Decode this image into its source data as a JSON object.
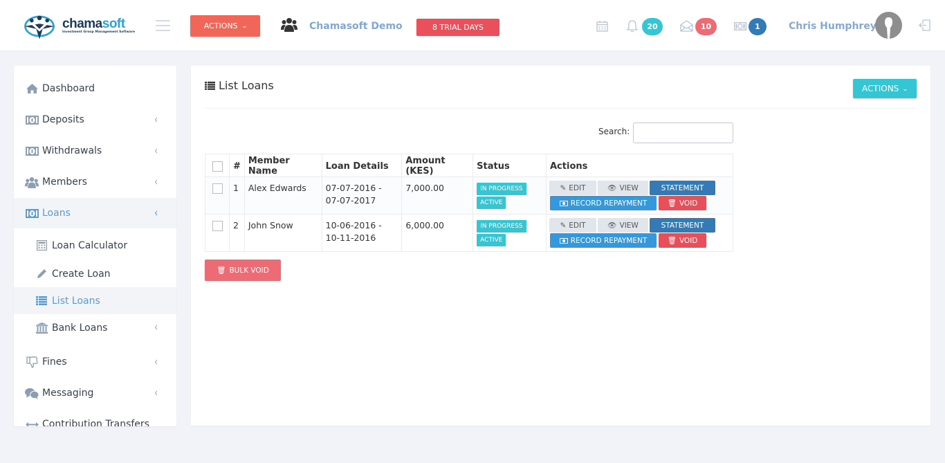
{
  "header": {
    "logo": {
      "name_part1": "chama",
      "name_part2": "soft",
      "tagline": "Investment Group Management Software"
    },
    "menu_icon": "hamburger-icon",
    "actions_label": "ACTIONS",
    "group_icon": "users-icon",
    "group_name": "Chamasoft Demo",
    "trial_label": "8 TRIAL DAYS",
    "notifications": [
      {
        "icon": "calendar-icon",
        "count": null
      },
      {
        "icon": "bell-icon",
        "count": "20",
        "color": "#36c6d3"
      },
      {
        "icon": "envelope-open-icon",
        "count": "10",
        "color": "#ed6b75"
      },
      {
        "icon": "money-icon",
        "count": "1",
        "color": "#337ab7"
      }
    ],
    "user_name": "Chris Humphreys",
    "logout_icon": "logout-icon"
  },
  "sidebar": {
    "items": [
      {
        "label": "Dashboard",
        "icon": "home-icon",
        "has_arrow": false
      },
      {
        "label": "Deposits",
        "icon": "money-icon",
        "has_arrow": true
      },
      {
        "label": "Withdrawals",
        "icon": "money-icon",
        "has_arrow": true
      },
      {
        "label": "Members",
        "icon": "users-icon",
        "has_arrow": true
      },
      {
        "label": "Loans",
        "icon": "money-icon",
        "has_arrow": true,
        "active": true
      },
      {
        "label": "Loan Calculator",
        "icon": "calculator-icon",
        "sub": true
      },
      {
        "label": "Create Loan",
        "icon": "pencil-icon",
        "sub": true
      },
      {
        "label": "List Loans",
        "icon": "list-icon",
        "sub": true,
        "active": true
      },
      {
        "label": "Bank Loans",
        "icon": "bank-icon",
        "sub": true,
        "has_arrow": true
      },
      {
        "label": "Fines",
        "icon": "thumbs-down-icon",
        "has_arrow": true
      },
      {
        "label": "Messaging",
        "icon": "chat-icon",
        "has_arrow": true
      },
      {
        "label": "Contribution Transfers",
        "icon": "arrows-h-icon",
        "has_arrow": false
      }
    ]
  },
  "main": {
    "title": "List Loans",
    "title_icon": "list-icon",
    "actions_label": "ACTIONS",
    "search": {
      "label": "Search:",
      "value": "",
      "placeholder": ""
    },
    "table": {
      "columns": [
        "",
        "#",
        "Member Name",
        "Loan Details",
        "Amount (KES)",
        "Status",
        "Actions"
      ],
      "rows": [
        {
          "num": "1",
          "member": "Alex Edwards",
          "start": "07-07-2016 -",
          "end": "07-07-2017",
          "amount": "7,000.00",
          "status": [
            "IN PROGRESS",
            "ACTIVE"
          ]
        },
        {
          "num": "2",
          "member": "John Snow",
          "start": "10-06-2016 -",
          "end": "10-11-2016",
          "amount": "6,000.00",
          "status": [
            "IN PROGRESS",
            "ACTIVE"
          ]
        }
      ],
      "row_actions": {
        "edit": "EDIT",
        "view": "VIEW",
        "statement": "STATEMENT",
        "record_repayment": "RECORD REPAYMENT",
        "void": "VOID"
      }
    },
    "bulk_void_label": "BULK VOID"
  }
}
